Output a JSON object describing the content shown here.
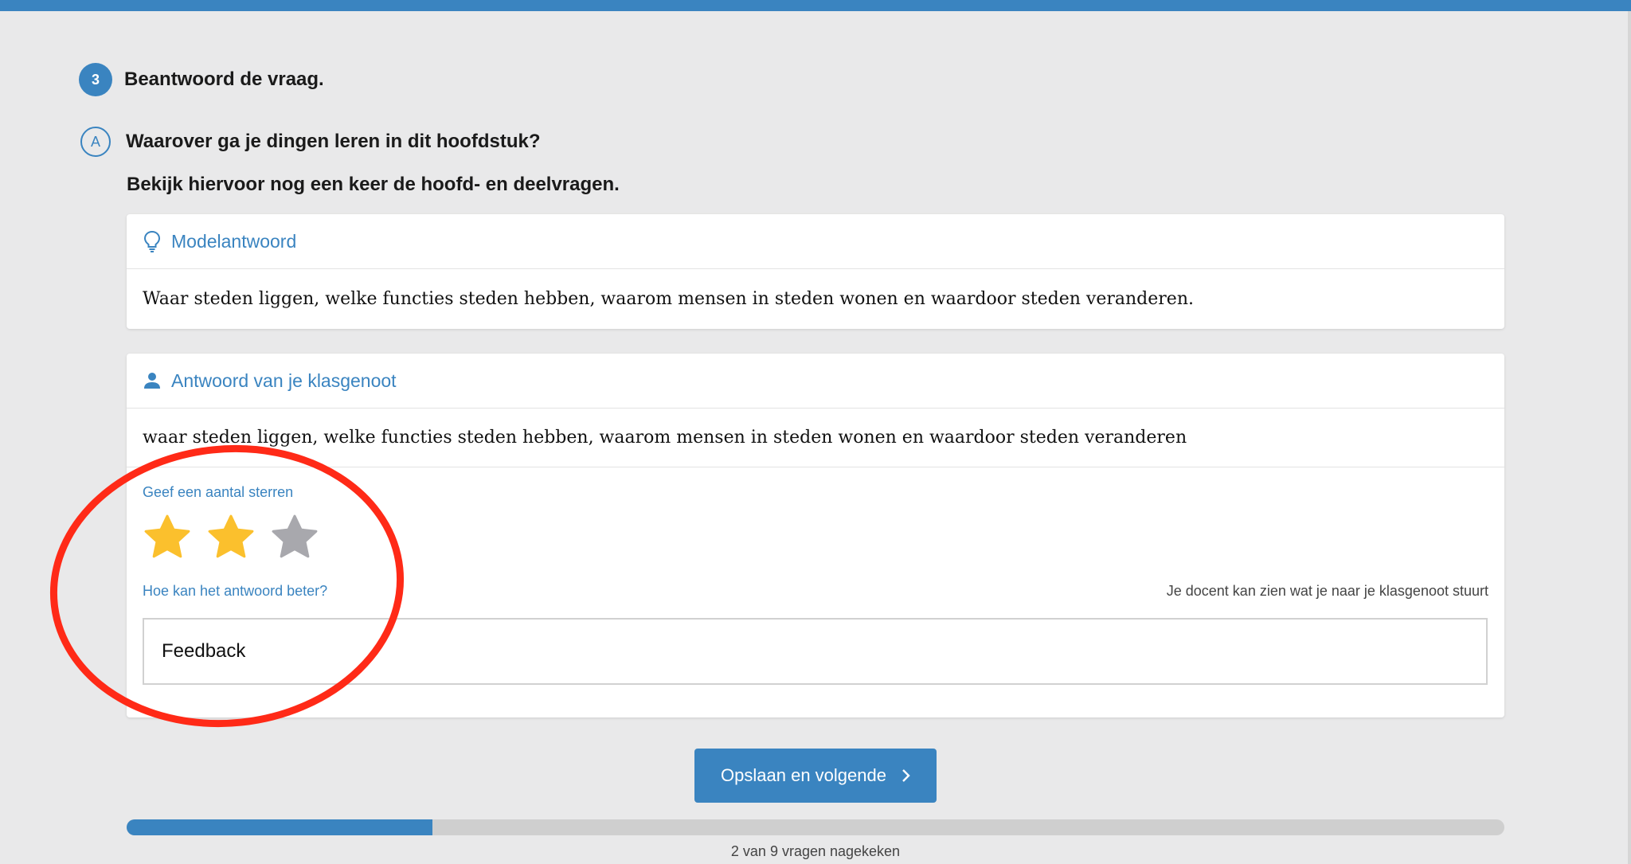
{
  "step": {
    "number": "3",
    "title": "Beantwoord de vraag."
  },
  "question": {
    "letter": "A",
    "text": "Waarover ga je dingen leren in dit hoofdstuk?",
    "instruction": "Bekijk hiervoor nog een keer de hoofd- en deelvragen."
  },
  "model_answer": {
    "title": "Modelantwoord",
    "icon": "lightbulb-icon",
    "text": "Waar steden liggen, welke functies steden hebben, waarom mensen in steden wonen en waardoor steden veranderen."
  },
  "peer_answer": {
    "title": "Antwoord van je klasgenoot",
    "icon": "person-icon",
    "text": "waar steden liggen, welke functies steden hebben, waarom mensen in steden wonen en waardoor steden veranderen"
  },
  "rating": {
    "label": "Geef een aantal sterren",
    "max": 3,
    "value": 2,
    "filled_color": "#fbc02d",
    "empty_color": "#a8a8ad"
  },
  "feedback": {
    "label": "Hoe kan het antwoord beter?",
    "note": "Je docent kan zien wat je naar je klasgenoot stuurt",
    "value": "Feedback"
  },
  "save_button": {
    "label": "Opslaan en volgende",
    "icon": "chevron-right-icon"
  },
  "progress": {
    "done": 2,
    "total": 9,
    "text": "2 van 9 vragen nagekeken"
  },
  "colors": {
    "accent": "#3a84c0",
    "annotation": "#ff2a17"
  }
}
